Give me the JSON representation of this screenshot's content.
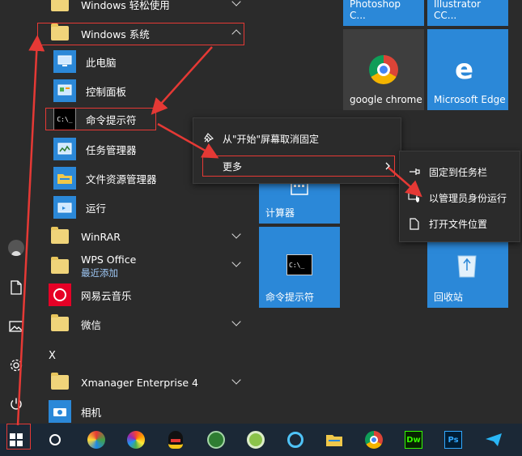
{
  "app_list": {
    "top_partial": "Windows 轻松使用",
    "group_expanded": "Windows 系统",
    "system_items": [
      "此电脑",
      "控制面板",
      "命令提示符",
      "任务管理器",
      "文件资源管理器",
      "运行"
    ],
    "winrar": "WinRAR",
    "wps": "WPS Office",
    "wps_sub": "最近添加",
    "netease": "网易云音乐",
    "weixin": "微信",
    "section_x": "X",
    "xmanager": "Xmanager Enterprise 4",
    "camera": "相机"
  },
  "tiles": {
    "photoshop": "Adobe Photoshop C...",
    "illustrator": "Adobe Illustrator CC...",
    "chrome": "google chrome",
    "edge": "Microsoft Edge",
    "calculator": "计算器",
    "cmd": "命令提示符",
    "recycle": "回收站"
  },
  "context_menu": {
    "unpin": "从\"开始\"屏幕取消固定",
    "more": "更多"
  },
  "more_menu": {
    "pin_taskbar": "固定到任务栏",
    "run_admin": "以管理员身份运行",
    "open_location": "打开文件位置"
  },
  "colors": {
    "tile_blue": "#2b88d8",
    "chrome_tile": "#3e3e3e",
    "highlight_red": "#e53935",
    "taskbar": "#1b2836"
  }
}
